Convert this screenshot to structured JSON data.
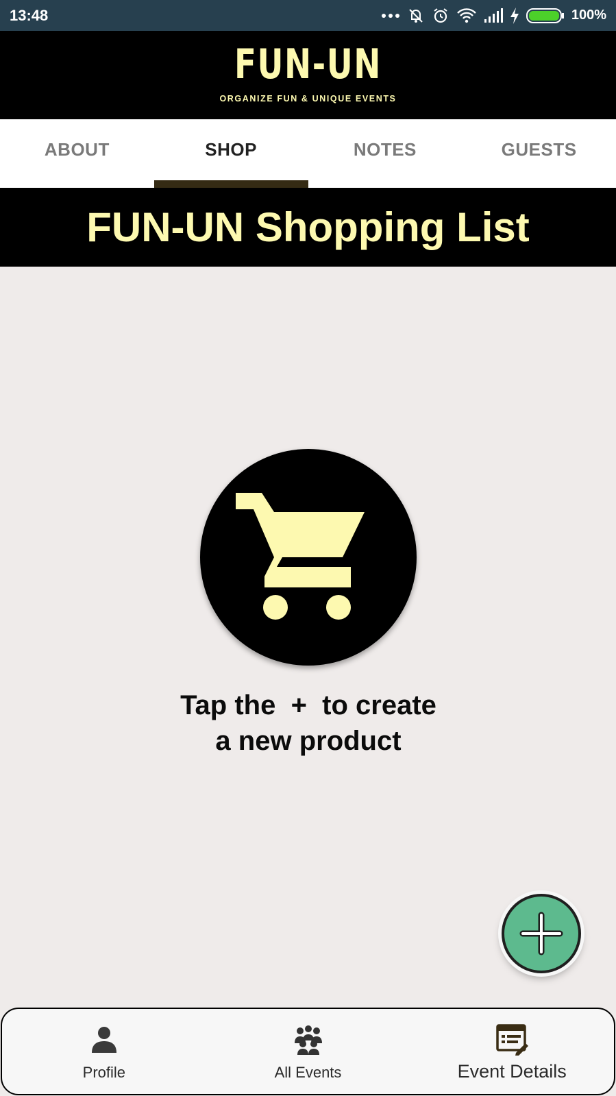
{
  "status_bar": {
    "time": "13:48",
    "battery_percent": "100%",
    "icons": [
      "more-dots-icon",
      "bell-off-icon",
      "alarm-icon",
      "wifi-icon",
      "signal-icon",
      "charging-icon",
      "battery-icon"
    ]
  },
  "header": {
    "logo_title": "FUN-UN",
    "logo_tagline": "ORGANIZE FUN & UNIQUE EVENTS"
  },
  "tabs": [
    {
      "label": "ABOUT",
      "active": false
    },
    {
      "label": "SHOP",
      "active": true
    },
    {
      "label": "NOTES",
      "active": false
    },
    {
      "label": "GUESTS",
      "active": false
    }
  ],
  "page_banner": {
    "title": "FUN-UN Shopping List"
  },
  "empty_state": {
    "icon": "shopping-cart-icon",
    "line1": "Tap the  +  to create",
    "line2": "a new product"
  },
  "fab": {
    "icon": "plus-icon"
  },
  "bottom_nav": [
    {
      "label": "Profile",
      "icon": "person-icon"
    },
    {
      "label": "All Events",
      "icon": "people-group-icon"
    },
    {
      "label": "Event Details",
      "icon": "event-details-icon"
    }
  ],
  "colors": {
    "accent_yellow": "#fdf9b0",
    "status_bar": "#27404f",
    "tab_indicator": "#352b14",
    "fab_green": "#5dba8e",
    "background": "#efebea",
    "battery_green": "#4cd02a"
  }
}
